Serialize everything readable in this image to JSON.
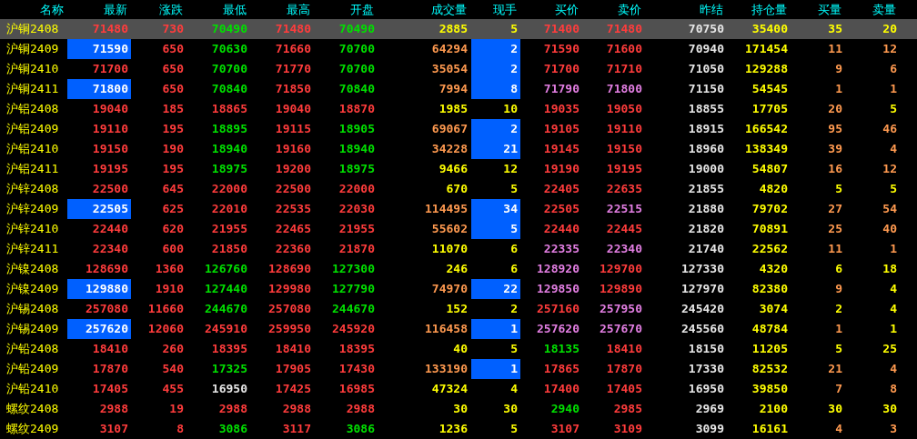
{
  "columns": [
    "名称",
    "最新",
    "涨跌",
    "最低",
    "最高",
    "开盘",
    "成交量",
    "现手",
    "买价",
    "卖价",
    "昨结",
    "持仓量",
    "买量",
    "卖量"
  ],
  "rows": [
    {
      "name": "沪铜2408",
      "selected": true,
      "last_flash": false,
      "tick_flash": false,
      "cells": [
        {
          "text": "71480",
          "color": "#ff3c3c"
        },
        {
          "text": "730",
          "color": "#ff3c3c"
        },
        {
          "text": "70490",
          "color": "#00e000"
        },
        {
          "text": "71480",
          "color": "#ff3c3c"
        },
        {
          "text": "70490",
          "color": "#00e000"
        },
        {
          "text": "2885",
          "color": "#ffff00"
        },
        {
          "text": "5",
          "color": "#ffff00"
        },
        {
          "text": "71400",
          "color": "#ff3c3c"
        },
        {
          "text": "71480",
          "color": "#ff3c3c"
        },
        {
          "text": "70750",
          "color": "#e6e6e6"
        },
        {
          "text": "35400",
          "color": "#ffff00"
        },
        {
          "text": "35",
          "color": "#ffff00"
        },
        {
          "text": "20",
          "color": "#ffff00"
        }
      ]
    },
    {
      "name": "沪铜2409",
      "selected": false,
      "last_flash": true,
      "tick_flash": true,
      "cells": [
        {
          "text": "71590",
          "color": "#ffffff"
        },
        {
          "text": "650",
          "color": "#ff3c3c"
        },
        {
          "text": "70630",
          "color": "#00e000"
        },
        {
          "text": "71660",
          "color": "#ff3c3c"
        },
        {
          "text": "70700",
          "color": "#00e000"
        },
        {
          "text": "64294",
          "color": "#ff9a50"
        },
        {
          "text": "2",
          "color": "#ffffff"
        },
        {
          "text": "71590",
          "color": "#ff3c3c"
        },
        {
          "text": "71600",
          "color": "#ff3c3c"
        },
        {
          "text": "70940",
          "color": "#e6e6e6"
        },
        {
          "text": "171454",
          "color": "#ffff00"
        },
        {
          "text": "11",
          "color": "#ff9a50"
        },
        {
          "text": "12",
          "color": "#ff9a50"
        }
      ]
    },
    {
      "name": "沪铜2410",
      "selected": false,
      "last_flash": false,
      "tick_flash": true,
      "cells": [
        {
          "text": "71700",
          "color": "#ff3c3c"
        },
        {
          "text": "650",
          "color": "#ff3c3c"
        },
        {
          "text": "70700",
          "color": "#00e000"
        },
        {
          "text": "71770",
          "color": "#ff3c3c"
        },
        {
          "text": "70700",
          "color": "#00e000"
        },
        {
          "text": "35054",
          "color": "#ff9a50"
        },
        {
          "text": "2",
          "color": "#ffffff"
        },
        {
          "text": "71700",
          "color": "#ff3c3c"
        },
        {
          "text": "71710",
          "color": "#ff3c3c"
        },
        {
          "text": "71050",
          "color": "#e6e6e6"
        },
        {
          "text": "129288",
          "color": "#ffff00"
        },
        {
          "text": "9",
          "color": "#ff9a50"
        },
        {
          "text": "6",
          "color": "#ff9a50"
        }
      ]
    },
    {
      "name": "沪铜2411",
      "selected": false,
      "last_flash": true,
      "tick_flash": true,
      "cells": [
        {
          "text": "71800",
          "color": "#ffffff"
        },
        {
          "text": "650",
          "color": "#ff3c3c"
        },
        {
          "text": "70840",
          "color": "#00e000"
        },
        {
          "text": "71850",
          "color": "#ff3c3c"
        },
        {
          "text": "70840",
          "color": "#00e000"
        },
        {
          "text": "7994",
          "color": "#ff9a50"
        },
        {
          "text": "8",
          "color": "#ffffff"
        },
        {
          "text": "71790",
          "color": "#e27ee2"
        },
        {
          "text": "71800",
          "color": "#e27ee2"
        },
        {
          "text": "71150",
          "color": "#e6e6e6"
        },
        {
          "text": "54545",
          "color": "#ffff00"
        },
        {
          "text": "1",
          "color": "#ff9a50"
        },
        {
          "text": "1",
          "color": "#ff9a50"
        }
      ]
    },
    {
      "name": "沪铝2408",
      "selected": false,
      "last_flash": false,
      "tick_flash": false,
      "cells": [
        {
          "text": "19040",
          "color": "#ff3c3c"
        },
        {
          "text": "185",
          "color": "#ff3c3c"
        },
        {
          "text": "18865",
          "color": "#ff3c3c"
        },
        {
          "text": "19040",
          "color": "#ff3c3c"
        },
        {
          "text": "18870",
          "color": "#ff3c3c"
        },
        {
          "text": "1985",
          "color": "#ffff00"
        },
        {
          "text": "10",
          "color": "#ffff00"
        },
        {
          "text": "19035",
          "color": "#ff3c3c"
        },
        {
          "text": "19050",
          "color": "#ff3c3c"
        },
        {
          "text": "18855",
          "color": "#e6e6e6"
        },
        {
          "text": "17705",
          "color": "#ffff00"
        },
        {
          "text": "20",
          "color": "#ff9a50"
        },
        {
          "text": "5",
          "color": "#ffff00"
        }
      ]
    },
    {
      "name": "沪铝2409",
      "selected": false,
      "last_flash": false,
      "tick_flash": true,
      "cells": [
        {
          "text": "19110",
          "color": "#ff3c3c"
        },
        {
          "text": "195",
          "color": "#ff3c3c"
        },
        {
          "text": "18895",
          "color": "#00e000"
        },
        {
          "text": "19115",
          "color": "#ff3c3c"
        },
        {
          "text": "18905",
          "color": "#00e000"
        },
        {
          "text": "69067",
          "color": "#ff9a50"
        },
        {
          "text": "2",
          "color": "#ffffff"
        },
        {
          "text": "19105",
          "color": "#ff3c3c"
        },
        {
          "text": "19110",
          "color": "#ff3c3c"
        },
        {
          "text": "18915",
          "color": "#e6e6e6"
        },
        {
          "text": "166542",
          "color": "#ffff00"
        },
        {
          "text": "95",
          "color": "#ff9a50"
        },
        {
          "text": "46",
          "color": "#ff9a50"
        }
      ]
    },
    {
      "name": "沪铝2410",
      "selected": false,
      "last_flash": false,
      "tick_flash": true,
      "cells": [
        {
          "text": "19150",
          "color": "#ff3c3c"
        },
        {
          "text": "190",
          "color": "#ff3c3c"
        },
        {
          "text": "18940",
          "color": "#00e000"
        },
        {
          "text": "19160",
          "color": "#ff3c3c"
        },
        {
          "text": "18940",
          "color": "#00e000"
        },
        {
          "text": "34228",
          "color": "#ff9a50"
        },
        {
          "text": "21",
          "color": "#ffffff"
        },
        {
          "text": "19145",
          "color": "#ff3c3c"
        },
        {
          "text": "19150",
          "color": "#ff3c3c"
        },
        {
          "text": "18960",
          "color": "#e6e6e6"
        },
        {
          "text": "138349",
          "color": "#ffff00"
        },
        {
          "text": "39",
          "color": "#ff9a50"
        },
        {
          "text": "4",
          "color": "#ff9a50"
        }
      ]
    },
    {
      "name": "沪铝2411",
      "selected": false,
      "last_flash": false,
      "tick_flash": false,
      "cells": [
        {
          "text": "19195",
          "color": "#ff3c3c"
        },
        {
          "text": "195",
          "color": "#ff3c3c"
        },
        {
          "text": "18975",
          "color": "#00e000"
        },
        {
          "text": "19200",
          "color": "#ff3c3c"
        },
        {
          "text": "18975",
          "color": "#00e000"
        },
        {
          "text": "9466",
          "color": "#ffff00"
        },
        {
          "text": "12",
          "color": "#ffff00"
        },
        {
          "text": "19190",
          "color": "#ff3c3c"
        },
        {
          "text": "19195",
          "color": "#ff3c3c"
        },
        {
          "text": "19000",
          "color": "#e6e6e6"
        },
        {
          "text": "54807",
          "color": "#ffff00"
        },
        {
          "text": "16",
          "color": "#ff9a50"
        },
        {
          "text": "12",
          "color": "#ff9a50"
        }
      ]
    },
    {
      "name": "沪锌2408",
      "selected": false,
      "last_flash": false,
      "tick_flash": false,
      "cells": [
        {
          "text": "22500",
          "color": "#ff3c3c"
        },
        {
          "text": "645",
          "color": "#ff3c3c"
        },
        {
          "text": "22000",
          "color": "#ff3c3c"
        },
        {
          "text": "22500",
          "color": "#ff3c3c"
        },
        {
          "text": "22000",
          "color": "#ff3c3c"
        },
        {
          "text": "670",
          "color": "#ffff00"
        },
        {
          "text": "5",
          "color": "#ffff00"
        },
        {
          "text": "22405",
          "color": "#ff3c3c"
        },
        {
          "text": "22635",
          "color": "#ff3c3c"
        },
        {
          "text": "21855",
          "color": "#e6e6e6"
        },
        {
          "text": "4820",
          "color": "#ffff00"
        },
        {
          "text": "5",
          "color": "#ffff00"
        },
        {
          "text": "5",
          "color": "#ffff00"
        }
      ]
    },
    {
      "name": "沪锌2409",
      "selected": false,
      "last_flash": true,
      "tick_flash": true,
      "cells": [
        {
          "text": "22505",
          "color": "#ffffff"
        },
        {
          "text": "625",
          "color": "#ff3c3c"
        },
        {
          "text": "22010",
          "color": "#ff3c3c"
        },
        {
          "text": "22535",
          "color": "#ff3c3c"
        },
        {
          "text": "22030",
          "color": "#ff3c3c"
        },
        {
          "text": "114495",
          "color": "#ff9a50"
        },
        {
          "text": "34",
          "color": "#ffffff"
        },
        {
          "text": "22505",
          "color": "#ff3c3c"
        },
        {
          "text": "22515",
          "color": "#e27ee2"
        },
        {
          "text": "21880",
          "color": "#e6e6e6"
        },
        {
          "text": "79702",
          "color": "#ffff00"
        },
        {
          "text": "27",
          "color": "#ff9a50"
        },
        {
          "text": "54",
          "color": "#ff9a50"
        }
      ]
    },
    {
      "name": "沪锌2410",
      "selected": false,
      "last_flash": false,
      "tick_flash": true,
      "cells": [
        {
          "text": "22440",
          "color": "#ff3c3c"
        },
        {
          "text": "620",
          "color": "#ff3c3c"
        },
        {
          "text": "21955",
          "color": "#ff3c3c"
        },
        {
          "text": "22465",
          "color": "#ff3c3c"
        },
        {
          "text": "21955",
          "color": "#ff3c3c"
        },
        {
          "text": "55602",
          "color": "#ff9a50"
        },
        {
          "text": "5",
          "color": "#ffffff"
        },
        {
          "text": "22440",
          "color": "#ff3c3c"
        },
        {
          "text": "22445",
          "color": "#ff3c3c"
        },
        {
          "text": "21820",
          "color": "#e6e6e6"
        },
        {
          "text": "70891",
          "color": "#ffff00"
        },
        {
          "text": "25",
          "color": "#ff9a50"
        },
        {
          "text": "40",
          "color": "#ff9a50"
        }
      ]
    },
    {
      "name": "沪锌2411",
      "selected": false,
      "last_flash": false,
      "tick_flash": false,
      "cells": [
        {
          "text": "22340",
          "color": "#ff3c3c"
        },
        {
          "text": "600",
          "color": "#ff3c3c"
        },
        {
          "text": "21850",
          "color": "#ff3c3c"
        },
        {
          "text": "22360",
          "color": "#ff3c3c"
        },
        {
          "text": "21870",
          "color": "#ff3c3c"
        },
        {
          "text": "11070",
          "color": "#ffff00"
        },
        {
          "text": "6",
          "color": "#ffff00"
        },
        {
          "text": "22335",
          "color": "#e27ee2"
        },
        {
          "text": "22340",
          "color": "#e27ee2"
        },
        {
          "text": "21740",
          "color": "#e6e6e6"
        },
        {
          "text": "22562",
          "color": "#ffff00"
        },
        {
          "text": "11",
          "color": "#ff9a50"
        },
        {
          "text": "1",
          "color": "#ff9a50"
        }
      ]
    },
    {
      "name": "沪镍2408",
      "selected": false,
      "last_flash": false,
      "tick_flash": false,
      "cells": [
        {
          "text": "128690",
          "color": "#ff3c3c"
        },
        {
          "text": "1360",
          "color": "#ff3c3c"
        },
        {
          "text": "126760",
          "color": "#00e000"
        },
        {
          "text": "128690",
          "color": "#ff3c3c"
        },
        {
          "text": "127300",
          "color": "#00e000"
        },
        {
          "text": "246",
          "color": "#ffff00"
        },
        {
          "text": "6",
          "color": "#ffff00"
        },
        {
          "text": "128920",
          "color": "#e27ee2"
        },
        {
          "text": "129700",
          "color": "#ff3c3c"
        },
        {
          "text": "127330",
          "color": "#e6e6e6"
        },
        {
          "text": "4320",
          "color": "#ffff00"
        },
        {
          "text": "6",
          "color": "#ffff00"
        },
        {
          "text": "18",
          "color": "#ffff00"
        }
      ]
    },
    {
      "name": "沪镍2409",
      "selected": false,
      "last_flash": true,
      "tick_flash": true,
      "cells": [
        {
          "text": "129880",
          "color": "#ffffff"
        },
        {
          "text": "1910",
          "color": "#ff3c3c"
        },
        {
          "text": "127440",
          "color": "#00e000"
        },
        {
          "text": "129980",
          "color": "#ff3c3c"
        },
        {
          "text": "127790",
          "color": "#00e000"
        },
        {
          "text": "74970",
          "color": "#ff9a50"
        },
        {
          "text": "22",
          "color": "#ffffff"
        },
        {
          "text": "129850",
          "color": "#e27ee2"
        },
        {
          "text": "129890",
          "color": "#ff3c3c"
        },
        {
          "text": "127970",
          "color": "#e6e6e6"
        },
        {
          "text": "82380",
          "color": "#ffff00"
        },
        {
          "text": "9",
          "color": "#ff9a50"
        },
        {
          "text": "4",
          "color": "#ffff00"
        }
      ]
    },
    {
      "name": "沪锡2408",
      "selected": false,
      "last_flash": false,
      "tick_flash": false,
      "cells": [
        {
          "text": "257080",
          "color": "#ff3c3c"
        },
        {
          "text": "11660",
          "color": "#ff3c3c"
        },
        {
          "text": "244670",
          "color": "#00e000"
        },
        {
          "text": "257080",
          "color": "#ff3c3c"
        },
        {
          "text": "244670",
          "color": "#00e000"
        },
        {
          "text": "152",
          "color": "#ffff00"
        },
        {
          "text": "2",
          "color": "#ffff00"
        },
        {
          "text": "257160",
          "color": "#ff3c3c"
        },
        {
          "text": "257950",
          "color": "#e27ee2"
        },
        {
          "text": "245420",
          "color": "#e6e6e6"
        },
        {
          "text": "3074",
          "color": "#ffff00"
        },
        {
          "text": "2",
          "color": "#ffff00"
        },
        {
          "text": "4",
          "color": "#ffff00"
        }
      ]
    },
    {
      "name": "沪锡2409",
      "selected": false,
      "last_flash": true,
      "tick_flash": true,
      "cells": [
        {
          "text": "257620",
          "color": "#ffffff"
        },
        {
          "text": "12060",
          "color": "#ff3c3c"
        },
        {
          "text": "245910",
          "color": "#ff3c3c"
        },
        {
          "text": "259950",
          "color": "#ff3c3c"
        },
        {
          "text": "245920",
          "color": "#ff3c3c"
        },
        {
          "text": "116458",
          "color": "#ff9a50"
        },
        {
          "text": "1",
          "color": "#ffffff"
        },
        {
          "text": "257620",
          "color": "#e27ee2"
        },
        {
          "text": "257670",
          "color": "#e27ee2"
        },
        {
          "text": "245560",
          "color": "#e6e6e6"
        },
        {
          "text": "48784",
          "color": "#ffff00"
        },
        {
          "text": "1",
          "color": "#ff9a50"
        },
        {
          "text": "1",
          "color": "#ffff00"
        }
      ]
    },
    {
      "name": "沪铅2408",
      "selected": false,
      "last_flash": false,
      "tick_flash": false,
      "cells": [
        {
          "text": "18410",
          "color": "#ff3c3c"
        },
        {
          "text": "260",
          "color": "#ff3c3c"
        },
        {
          "text": "18395",
          "color": "#ff3c3c"
        },
        {
          "text": "18410",
          "color": "#ff3c3c"
        },
        {
          "text": "18395",
          "color": "#ff3c3c"
        },
        {
          "text": "40",
          "color": "#ffff00"
        },
        {
          "text": "5",
          "color": "#ffff00"
        },
        {
          "text": "18135",
          "color": "#00e000"
        },
        {
          "text": "18410",
          "color": "#ff3c3c"
        },
        {
          "text": "18150",
          "color": "#e6e6e6"
        },
        {
          "text": "11205",
          "color": "#ffff00"
        },
        {
          "text": "5",
          "color": "#ffff00"
        },
        {
          "text": "25",
          "color": "#ffff00"
        }
      ]
    },
    {
      "name": "沪铅2409",
      "selected": false,
      "last_flash": false,
      "tick_flash": true,
      "cells": [
        {
          "text": "17870",
          "color": "#ff3c3c"
        },
        {
          "text": "540",
          "color": "#ff3c3c"
        },
        {
          "text": "17325",
          "color": "#00e000"
        },
        {
          "text": "17905",
          "color": "#ff3c3c"
        },
        {
          "text": "17430",
          "color": "#ff3c3c"
        },
        {
          "text": "133190",
          "color": "#ff9a50"
        },
        {
          "text": "1",
          "color": "#ffffff"
        },
        {
          "text": "17865",
          "color": "#ff3c3c"
        },
        {
          "text": "17870",
          "color": "#ff3c3c"
        },
        {
          "text": "17330",
          "color": "#e6e6e6"
        },
        {
          "text": "82532",
          "color": "#ffff00"
        },
        {
          "text": "21",
          "color": "#ff9a50"
        },
        {
          "text": "4",
          "color": "#ff9a50"
        }
      ]
    },
    {
      "name": "沪铅2410",
      "selected": false,
      "last_flash": false,
      "tick_flash": false,
      "cells": [
        {
          "text": "17405",
          "color": "#ff3c3c"
        },
        {
          "text": "455",
          "color": "#ff3c3c"
        },
        {
          "text": "16950",
          "color": "#e6e6e6"
        },
        {
          "text": "17425",
          "color": "#ff3c3c"
        },
        {
          "text": "16985",
          "color": "#ff3c3c"
        },
        {
          "text": "47324",
          "color": "#ffff00"
        },
        {
          "text": "4",
          "color": "#ffff00"
        },
        {
          "text": "17400",
          "color": "#ff3c3c"
        },
        {
          "text": "17405",
          "color": "#ff3c3c"
        },
        {
          "text": "16950",
          "color": "#e6e6e6"
        },
        {
          "text": "39850",
          "color": "#ffff00"
        },
        {
          "text": "7",
          "color": "#ff9a50"
        },
        {
          "text": "8",
          "color": "#ff9a50"
        }
      ]
    },
    {
      "name": "螺纹2408",
      "selected": false,
      "last_flash": false,
      "tick_flash": false,
      "cells": [
        {
          "text": "2988",
          "color": "#ff3c3c"
        },
        {
          "text": "19",
          "color": "#ff3c3c"
        },
        {
          "text": "2988",
          "color": "#ff3c3c"
        },
        {
          "text": "2988",
          "color": "#ff3c3c"
        },
        {
          "text": "2988",
          "color": "#ff3c3c"
        },
        {
          "text": "30",
          "color": "#ffff00"
        },
        {
          "text": "30",
          "color": "#ffff00"
        },
        {
          "text": "2940",
          "color": "#00e000"
        },
        {
          "text": "2985",
          "color": "#ff3c3c"
        },
        {
          "text": "2969",
          "color": "#e6e6e6"
        },
        {
          "text": "2100",
          "color": "#ffff00"
        },
        {
          "text": "30",
          "color": "#ffff00"
        },
        {
          "text": "30",
          "color": "#ffff00"
        }
      ]
    },
    {
      "name": "螺纹2409",
      "selected": false,
      "last_flash": false,
      "tick_flash": false,
      "cells": [
        {
          "text": "3107",
          "color": "#ff3c3c"
        },
        {
          "text": "8",
          "color": "#ff3c3c"
        },
        {
          "text": "3086",
          "color": "#00e000"
        },
        {
          "text": "3117",
          "color": "#ff3c3c"
        },
        {
          "text": "3086",
          "color": "#00e000"
        },
        {
          "text": "1236",
          "color": "#ffff00"
        },
        {
          "text": "5",
          "color": "#ffff00"
        },
        {
          "text": "3107",
          "color": "#ff3c3c"
        },
        {
          "text": "3109",
          "color": "#ff3c3c"
        },
        {
          "text": "3099",
          "color": "#e6e6e6"
        },
        {
          "text": "16161",
          "color": "#ffff00"
        },
        {
          "text": "4",
          "color": "#ff9a50"
        },
        {
          "text": "3",
          "color": "#ff9a50"
        }
      ]
    }
  ]
}
